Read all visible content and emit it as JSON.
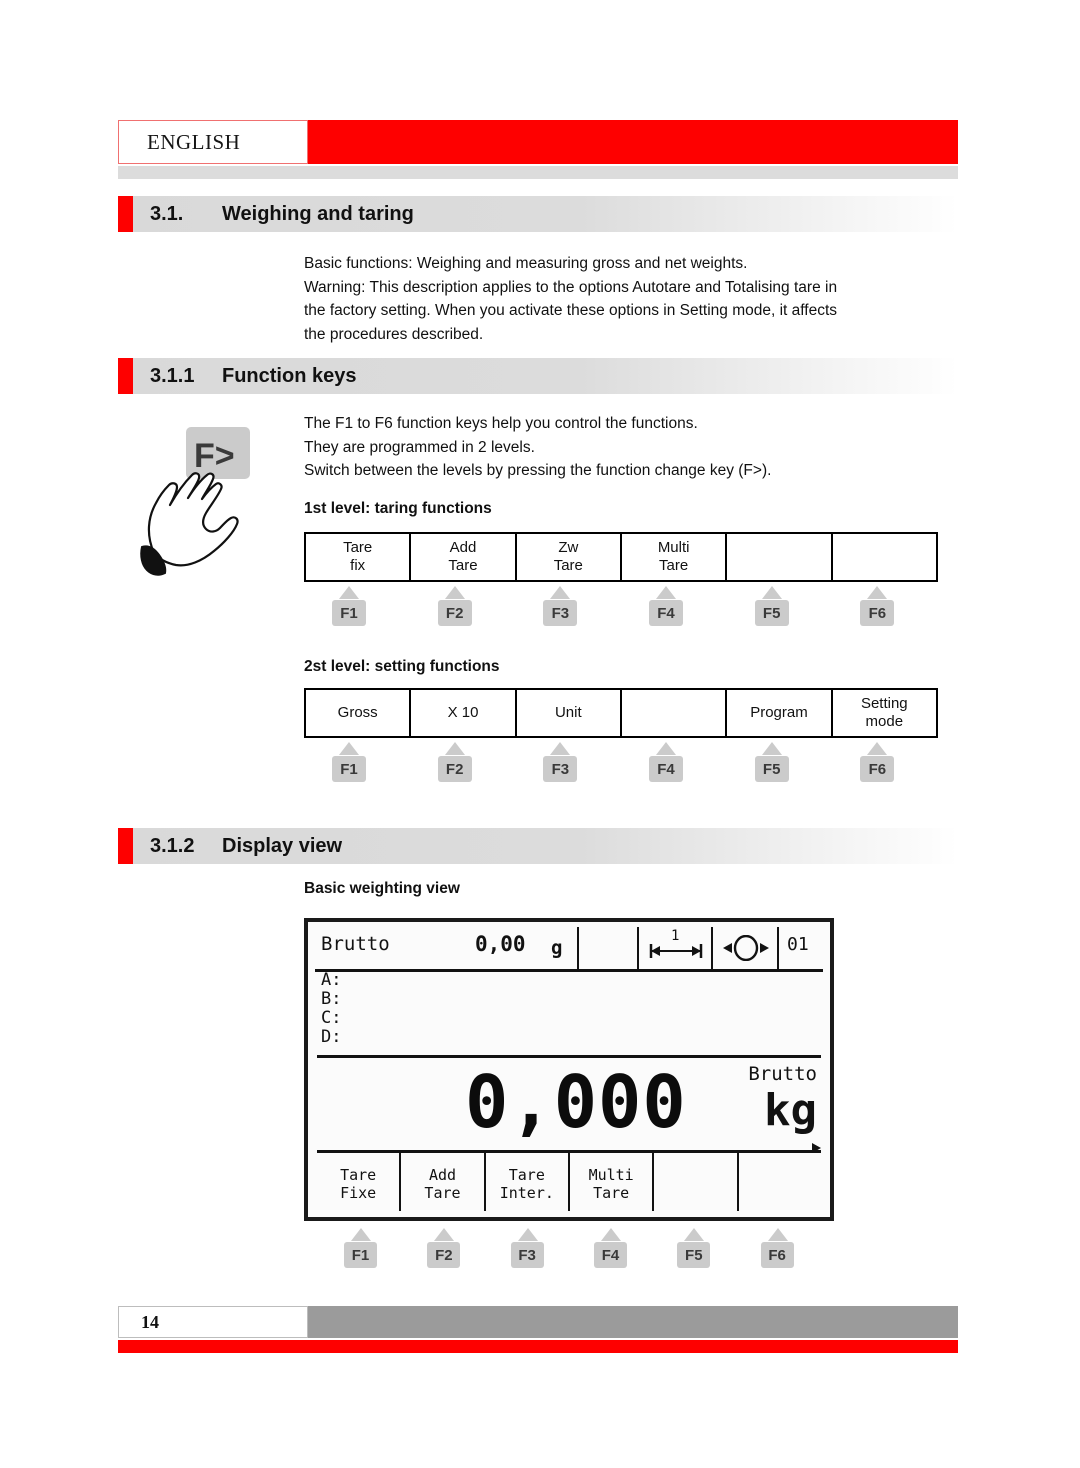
{
  "header": {
    "language_tab": "ENGLISH"
  },
  "sections": {
    "weighing": {
      "number": "3.1.",
      "title": "Weighing and taring",
      "paragraph": [
        "Basic functions: Weighing and measuring gross and net weights.",
        "Warning: This description applies to the options Autotare and Totalising tare in",
        "the factory setting. When you activate these options in Setting mode, it affects",
        "the procedures described."
      ]
    },
    "function_keys": {
      "number": "3.1.1",
      "title": "Function keys",
      "paragraph": [
        "The F1 to F6 function keys help you control the functions.",
        "They are programmed in 2 levels.",
        "Switch between the levels by pressing the function change key (F>)."
      ],
      "change_key_label": "F>",
      "level1": {
        "label": "1st level: taring functions",
        "cells": [
          {
            "line1": "Tare",
            "line2": "fix"
          },
          {
            "line1": "Add",
            "line2": "Tare"
          },
          {
            "line1": "Zw",
            "line2": "Tare"
          },
          {
            "line1": "Multi",
            "line2": "Tare"
          },
          {
            "line1": "",
            "line2": ""
          },
          {
            "line1": "",
            "line2": ""
          }
        ]
      },
      "level2": {
        "label": "2st level: setting functions",
        "cells": [
          {
            "line1": "Gross",
            "line2": ""
          },
          {
            "line1": "X 10",
            "line2": ""
          },
          {
            "line1": "Unit",
            "line2": ""
          },
          {
            "line1": "",
            "line2": ""
          },
          {
            "line1": "Program",
            "line2": ""
          },
          {
            "line1": "Setting",
            "line2": "mode"
          }
        ]
      },
      "fkeys": [
        "F1",
        "F2",
        "F3",
        "F4",
        "F5",
        "F6"
      ]
    },
    "display_view": {
      "number": "3.1.2",
      "title": "Display view",
      "subtitle": "Basic weighting view",
      "fkeys": [
        "F1",
        "F2",
        "F3",
        "F4",
        "F5",
        "F6"
      ]
    }
  },
  "lcd": {
    "top_mode": "Brutto",
    "top_weight": "0,00",
    "top_unit": "g",
    "range_indicator": "1",
    "position_number": "01",
    "rows": [
      "A:",
      "B:",
      "C:",
      "D:"
    ],
    "main_weight": "0,000",
    "main_mode": "Brutto",
    "main_unit": "kg",
    "softkeys": [
      {
        "line1": "Tare",
        "line2": "Fixe"
      },
      {
        "line1": "Add",
        "line2": "Tare"
      },
      {
        "line1": "Tare",
        "line2": "Inter."
      },
      {
        "line1": "Multi",
        "line2": "Tare"
      },
      {
        "line1": "",
        "line2": ""
      },
      {
        "line1": "",
        "line2": ""
      }
    ]
  },
  "footer": {
    "page_number": "14"
  },
  "colors": {
    "brand_red": "#fe0000",
    "heading_grey": "#dcdcdc",
    "footer_grey": "#9b9b9b",
    "key_grey": "#cbcbcb"
  }
}
